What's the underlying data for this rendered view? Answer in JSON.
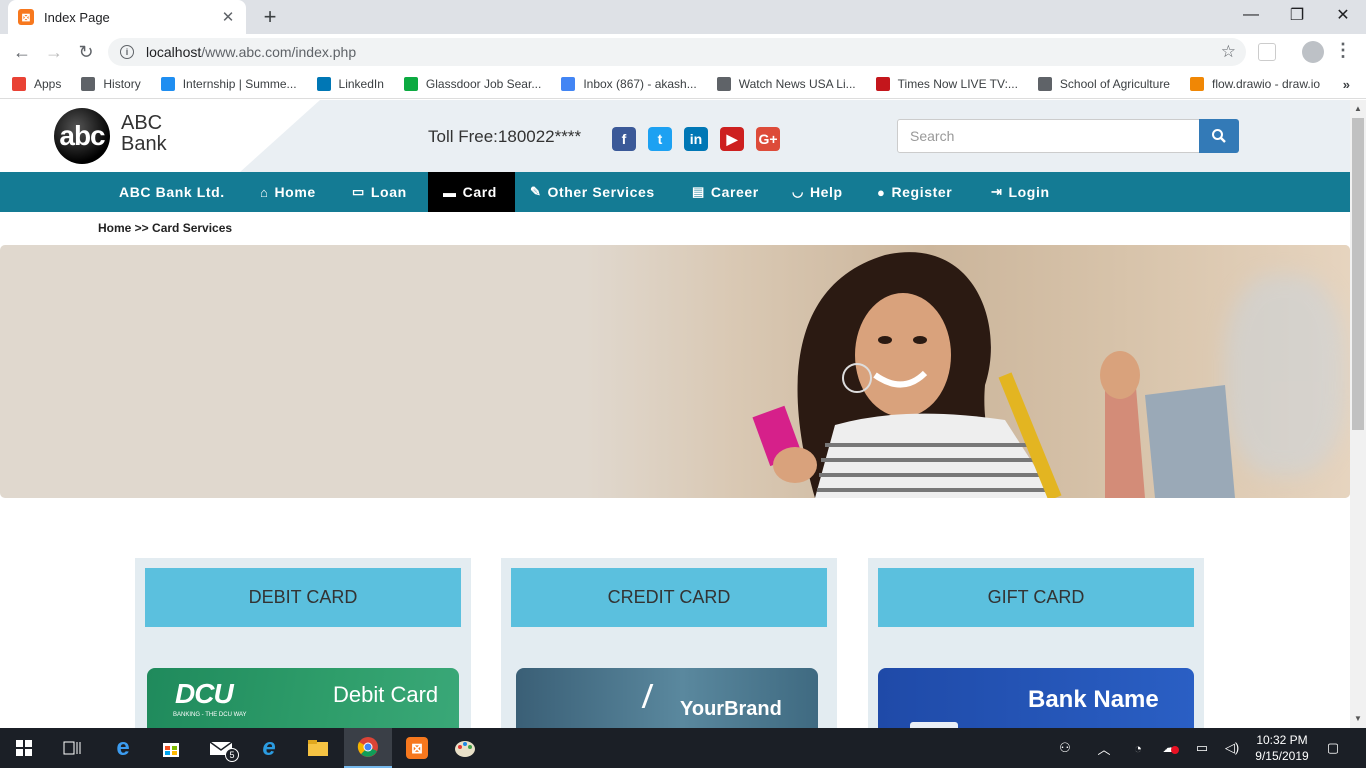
{
  "browser": {
    "tab_title": "Index Page",
    "url_host": "localhost",
    "url_path": "/www.abc.com/index.php",
    "bookmarks": [
      {
        "label": "Apps",
        "icon": "apps-grid-icon",
        "color": "#e94235"
      },
      {
        "label": "History",
        "icon": "history-icon",
        "color": "#5f6368"
      },
      {
        "label": "Internship | Summe...",
        "icon": "internshala-icon",
        "color": "#1f8ef1"
      },
      {
        "label": "LinkedIn",
        "icon": "linkedin-icon",
        "color": "#0077b5"
      },
      {
        "label": "Glassdoor Job Sear...",
        "icon": "glassdoor-icon",
        "color": "#0caa41"
      },
      {
        "label": "Inbox (867) - akash...",
        "icon": "google-icon",
        "color": "#4285f4"
      },
      {
        "label": "Watch News USA Li...",
        "icon": "globe-icon",
        "color": "#5f6368"
      },
      {
        "label": "Times Now LIVE TV:...",
        "icon": "times-now-icon",
        "color": "#c4161c"
      },
      {
        "label": "School of Agriculture",
        "icon": "globe-icon",
        "color": "#5f6368"
      },
      {
        "label": "flow.drawio - draw.io",
        "icon": "drawio-icon",
        "color": "#f08705"
      }
    ]
  },
  "site": {
    "logo_mark": "abc",
    "logo_line1": "ABC",
    "logo_line2": "Bank",
    "toll_free": "Toll Free:180022****",
    "search_placeholder": "Search",
    "social": [
      {
        "icon": "facebook-icon",
        "glyph": "f",
        "color": "#3b5998"
      },
      {
        "icon": "twitter-icon",
        "glyph": "t",
        "color": "#1da1f2"
      },
      {
        "icon": "linkedin-icon",
        "glyph": "in",
        "color": "#0077b5"
      },
      {
        "icon": "youtube-icon",
        "glyph": "▶",
        "color": "#cd201f"
      },
      {
        "icon": "google-plus-icon",
        "glyph": "G+",
        "color": "#dd4b39"
      }
    ],
    "nav": [
      {
        "label": "ABC Bank Ltd.",
        "icon": ""
      },
      {
        "label": "Home",
        "icon": "⌂"
      },
      {
        "label": "Loan",
        "icon": "▭"
      },
      {
        "label": "Card",
        "icon": "▬"
      },
      {
        "label": "Other Services",
        "icon": "✎"
      },
      {
        "label": "Career",
        "icon": "▤"
      },
      {
        "label": "Help",
        "icon": "◡"
      },
      {
        "label": "Register",
        "icon": "●"
      },
      {
        "label": "Login",
        "icon": "⇥"
      }
    ],
    "active_nav": "Card",
    "breadcrumb": "Home >> Card Services",
    "cards": [
      {
        "title": "DEBIT CARD",
        "brand": "DCU",
        "tagline": "BANKING - THE DCU WAY",
        "label": "Debit Card"
      },
      {
        "title": "CREDIT CARD",
        "brand": "YourBrand"
      },
      {
        "title": "GIFT CARD",
        "brand": "Bank Name"
      }
    ]
  },
  "taskbar": {
    "mail_badge": "5",
    "time": "10:32 PM",
    "date": "9/15/2019"
  }
}
